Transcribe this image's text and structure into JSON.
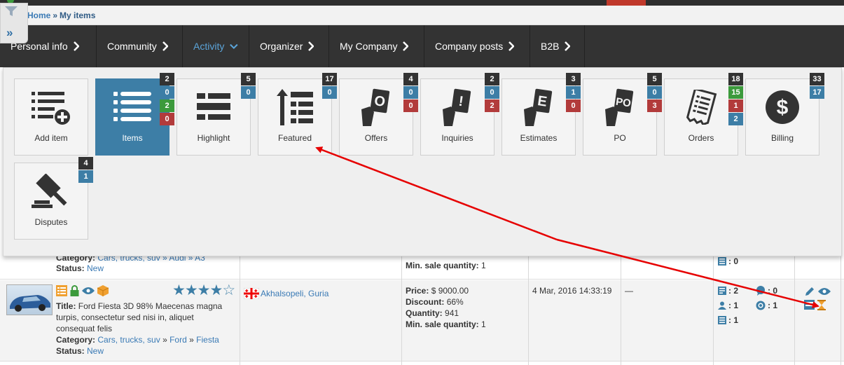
{
  "breadcrumb": {
    "home": "Home",
    "separator": "»",
    "current": "My items"
  },
  "nav": {
    "tabs": [
      {
        "label": "Personal info",
        "active": false
      },
      {
        "label": "Community",
        "active": false
      },
      {
        "label": "Activity",
        "active": true
      },
      {
        "label": "Organizer",
        "active": false
      },
      {
        "label": "My Company",
        "active": false
      },
      {
        "label": "Company posts",
        "active": false
      },
      {
        "label": "B2B",
        "active": false
      }
    ]
  },
  "panel": {
    "tiles": [
      {
        "label": "Add item",
        "icon": "add-list-icon",
        "badges": []
      },
      {
        "label": "Items",
        "icon": "list-icon",
        "badges": [
          "2",
          "0",
          "2",
          "0"
        ]
      },
      {
        "label": "Highlight",
        "icon": "highlight-icon",
        "badges": [
          "5",
          "0"
        ]
      },
      {
        "label": "Featured",
        "icon": "featured-icon",
        "badges": [
          "17",
          "0"
        ]
      },
      {
        "label": "Offers",
        "icon": "offers-icon",
        "badges": [
          "4",
          "0",
          "0"
        ]
      },
      {
        "label": "Inquiries",
        "icon": "inquiries-icon",
        "badges": [
          "2",
          "0",
          "2"
        ]
      },
      {
        "label": "Estimates",
        "icon": "estimates-icon",
        "badges": [
          "3",
          "1",
          "0"
        ]
      },
      {
        "label": "PO",
        "icon": "po-icon",
        "badges": [
          "5",
          "0",
          "3"
        ]
      },
      {
        "label": "Orders",
        "icon": "orders-icon",
        "badges": [
          "18",
          "15",
          "1",
          "2"
        ]
      },
      {
        "label": "Billing",
        "icon": "billing-icon",
        "badges": [
          "33",
          "17"
        ]
      },
      {
        "label": "Disputes",
        "icon": "gavel-icon",
        "badges": [
          "4",
          "1"
        ]
      }
    ]
  },
  "colors": {
    "nav_bg": "#333333",
    "accent_blue": "#3d7ea6",
    "active_text": "#5ba4d9",
    "badge_green": "#3c9a3c",
    "badge_red": "#b23b3b",
    "annotation_arrow": "#e60000"
  },
  "table": {
    "row1": {
      "category_label": "Category:",
      "category_value": "Cars, trucks, suv » Audi » A3",
      "status_label": "Status:",
      "status_value": "New",
      "min_sale_label": "Min. sale quantity:",
      "min_sale_value": "1",
      "list_count": ": 0"
    },
    "row2": {
      "rating": 4,
      "location": "Akhalsopeli, Guria",
      "title_label": "Title:",
      "title_value": "Ford Fiesta 3D 98% Maecenas magna turpis, consectetur sed nisi in, aliquet consequat felis",
      "category_label": "Category:",
      "category_path": [
        "Cars, trucks, suv",
        "Ford",
        "Fiesta"
      ],
      "category_sep": "»",
      "status_label": "Status:",
      "status_value": "New",
      "price_label": "Price:",
      "price_value": "$ 9000.00",
      "discount_label": "Discount:",
      "discount_value": "66%",
      "quantity_label": "Quantity:",
      "quantity_value": "941",
      "min_sale_label": "Min. sale quantity:",
      "min_sale_value": "1",
      "date": "4 Mar, 2016 14:33:19",
      "dash": "—",
      "stats": {
        "docs": ": 2",
        "comments": ": 0",
        "users": ": 1",
        "support": ": 1",
        "lists": ": 1"
      }
    }
  }
}
